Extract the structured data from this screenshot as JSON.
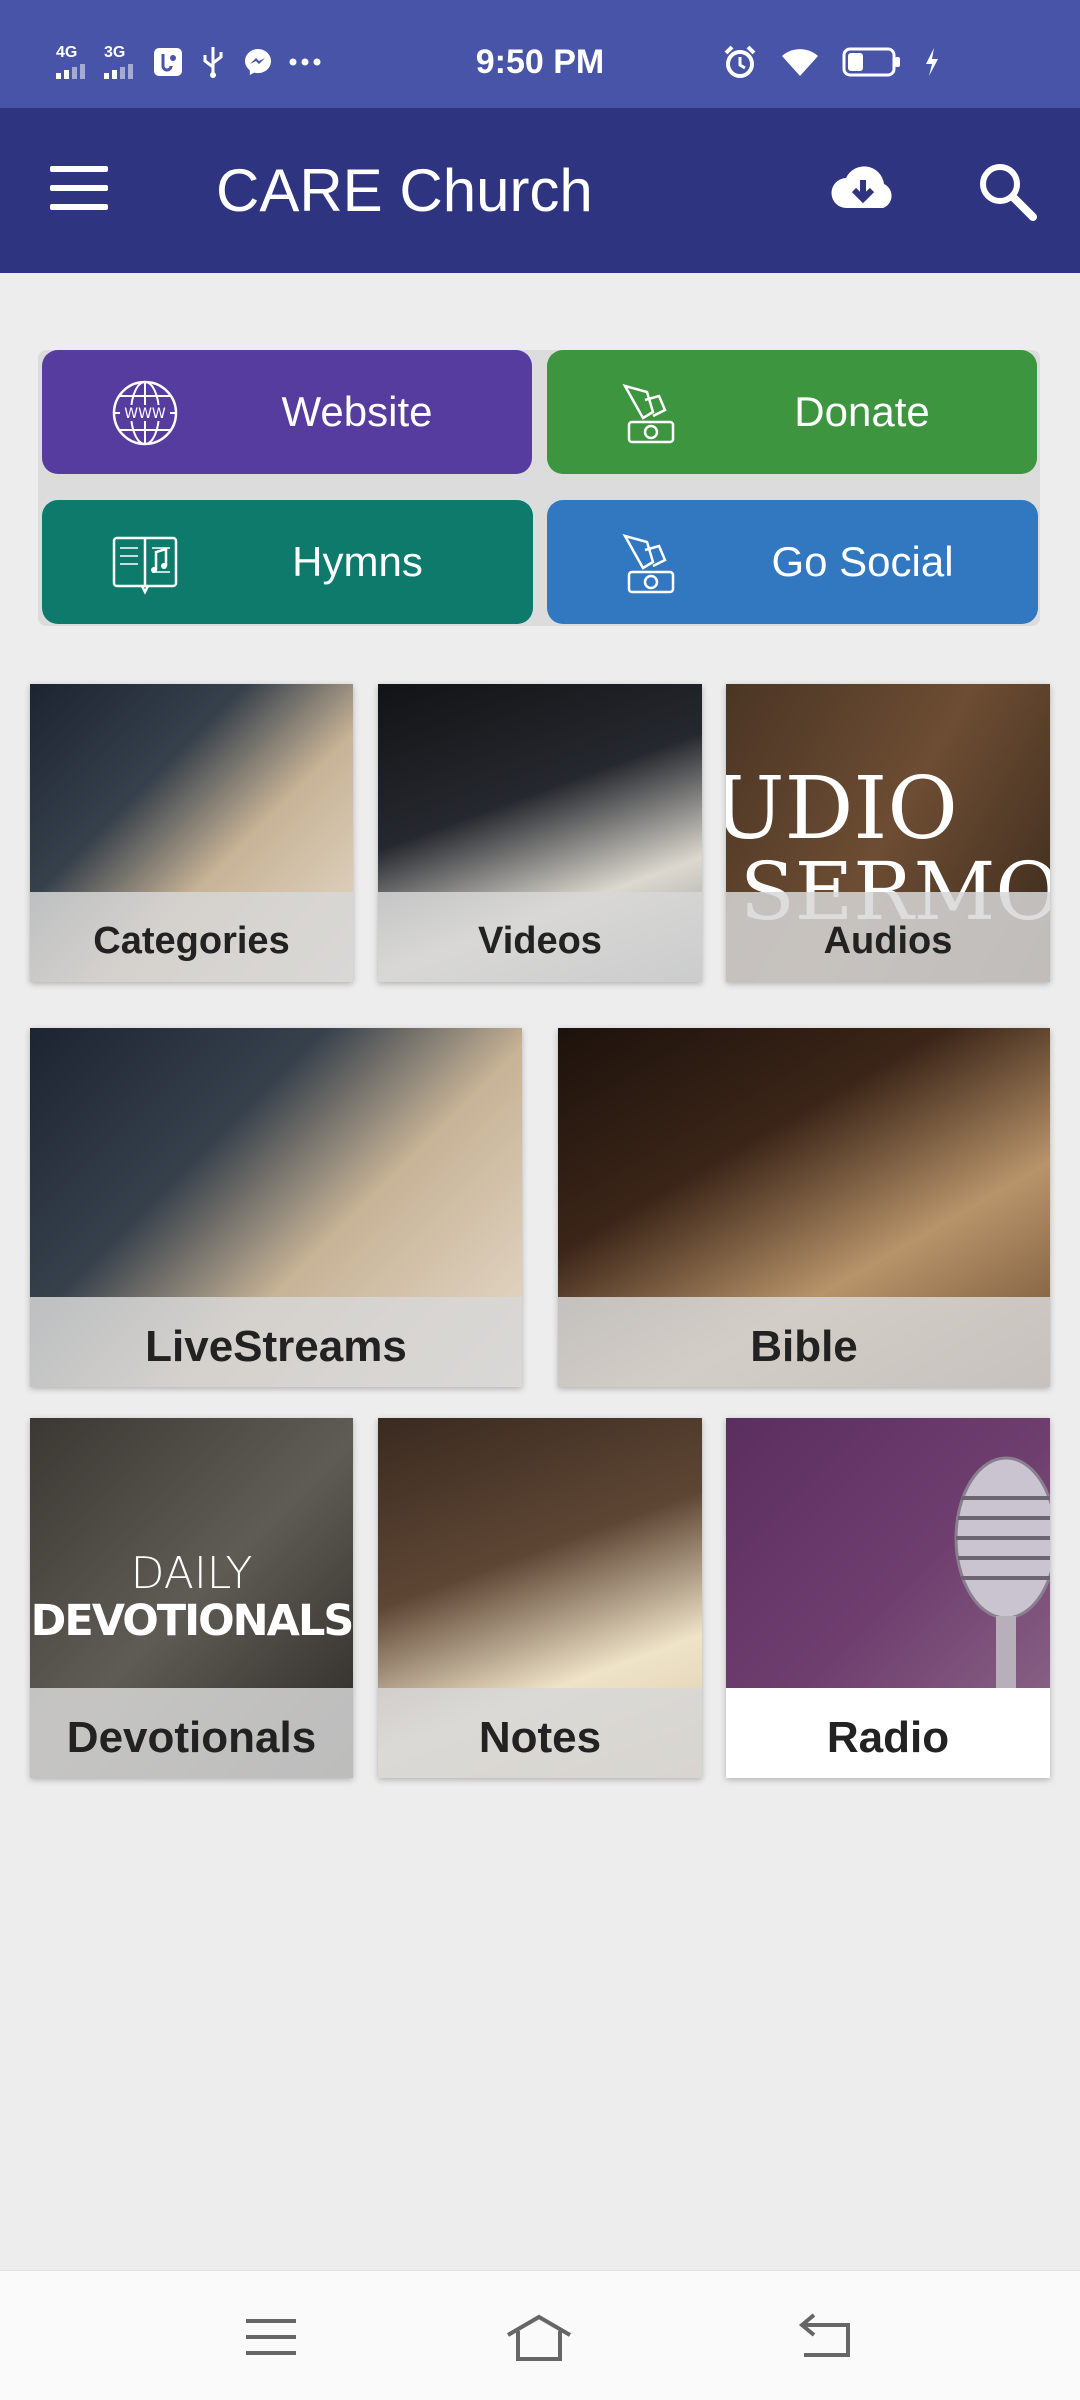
{
  "status_bar": {
    "network_1": "4G",
    "network_2": "3G",
    "time": "9:50 PM",
    "icons": [
      "usb-debug-icon",
      "usb-icon",
      "messenger-icon",
      "more-dots-icon",
      "alarm-icon",
      "wifi-icon",
      "battery-icon",
      "charging-icon"
    ],
    "battery_level": 0.35
  },
  "app_bar": {
    "title": "CARE Church",
    "background": "#2f3480",
    "icons": [
      "menu-icon",
      "cloud-download-icon",
      "search-icon"
    ]
  },
  "quick_buttons": [
    {
      "label": "Website",
      "color": "#553c9e",
      "icon": "globe-www-icon"
    },
    {
      "label": "Donate",
      "color": "#3e9540",
      "icon": "donate-hand-icon"
    },
    {
      "label": "Hymns",
      "color": "#0d7a6c",
      "icon": "hymn-book-icon"
    },
    {
      "label": "Go Social",
      "color": "#3278c0",
      "icon": "social-hand-icon"
    }
  ],
  "tiles": [
    {
      "label": "Categories"
    },
    {
      "label": "Videos"
    },
    {
      "label": "Audios",
      "image_text_1": "UDIO",
      "image_text_2": "SERMON"
    },
    {
      "label": "LiveStreams"
    },
    {
      "label": "Bible"
    },
    {
      "label": "Devotionals",
      "image_text_1": "DAILY",
      "image_text_2": "DEVOTIONALS"
    },
    {
      "label": "Notes"
    },
    {
      "label": "Radio"
    }
  ],
  "nav_bar": {
    "icons": [
      "recent-apps-icon",
      "home-icon",
      "back-icon"
    ]
  }
}
